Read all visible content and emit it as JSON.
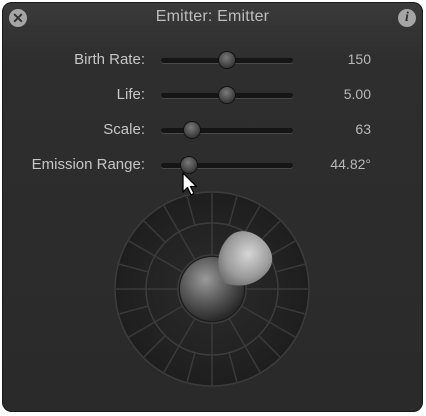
{
  "window": {
    "title": "Emitter: Emitter",
    "close_icon": "close-icon",
    "info_icon": "info-icon",
    "info_glyph": "i",
    "close_glyph": "✕"
  },
  "parameters": [
    {
      "label": "Birth Rate:",
      "value": "150",
      "slider_fraction": 0.5
    },
    {
      "label": "Life:",
      "value": "5.00",
      "slider_fraction": 0.5
    },
    {
      "label": "Scale:",
      "value": "63",
      "slider_fraction": 0.2
    },
    {
      "label": "Emission Range:",
      "value": "44.82°",
      "slider_fraction": 0.17
    }
  ],
  "emission_dial": {
    "emission_range_deg": 44.82,
    "emission_direction_deg": 40
  },
  "colors": {
    "panel_bg": "#2e2e2e",
    "text": "#c6c6c6"
  }
}
